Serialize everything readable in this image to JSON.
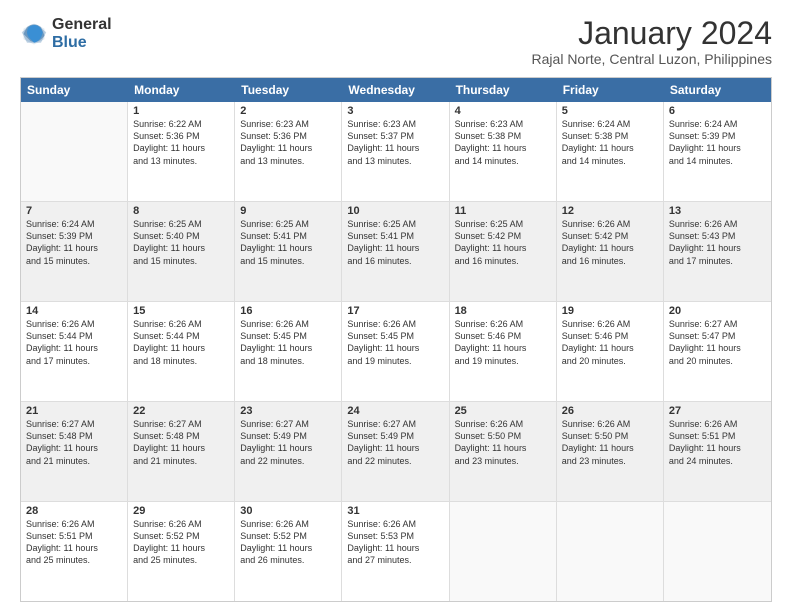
{
  "logo": {
    "line1": "General",
    "line2": "Blue"
  },
  "title": "January 2024",
  "subtitle": "Rajal Norte, Central Luzon, Philippines",
  "header_days": [
    "Sunday",
    "Monday",
    "Tuesday",
    "Wednesday",
    "Thursday",
    "Friday",
    "Saturday"
  ],
  "weeks": [
    [
      {
        "day": "",
        "lines": [],
        "empty": true
      },
      {
        "day": "1",
        "lines": [
          "Sunrise: 6:22 AM",
          "Sunset: 5:36 PM",
          "Daylight: 11 hours",
          "and 13 minutes."
        ]
      },
      {
        "day": "2",
        "lines": [
          "Sunrise: 6:23 AM",
          "Sunset: 5:36 PM",
          "Daylight: 11 hours",
          "and 13 minutes."
        ]
      },
      {
        "day": "3",
        "lines": [
          "Sunrise: 6:23 AM",
          "Sunset: 5:37 PM",
          "Daylight: 11 hours",
          "and 13 minutes."
        ]
      },
      {
        "day": "4",
        "lines": [
          "Sunrise: 6:23 AM",
          "Sunset: 5:38 PM",
          "Daylight: 11 hours",
          "and 14 minutes."
        ]
      },
      {
        "day": "5",
        "lines": [
          "Sunrise: 6:24 AM",
          "Sunset: 5:38 PM",
          "Daylight: 11 hours",
          "and 14 minutes."
        ]
      },
      {
        "day": "6",
        "lines": [
          "Sunrise: 6:24 AM",
          "Sunset: 5:39 PM",
          "Daylight: 11 hours",
          "and 14 minutes."
        ]
      }
    ],
    [
      {
        "day": "7",
        "lines": [
          "Sunrise: 6:24 AM",
          "Sunset: 5:39 PM",
          "Daylight: 11 hours",
          "and 15 minutes."
        ]
      },
      {
        "day": "8",
        "lines": [
          "Sunrise: 6:25 AM",
          "Sunset: 5:40 PM",
          "Daylight: 11 hours",
          "and 15 minutes."
        ]
      },
      {
        "day": "9",
        "lines": [
          "Sunrise: 6:25 AM",
          "Sunset: 5:41 PM",
          "Daylight: 11 hours",
          "and 15 minutes."
        ]
      },
      {
        "day": "10",
        "lines": [
          "Sunrise: 6:25 AM",
          "Sunset: 5:41 PM",
          "Daylight: 11 hours",
          "and 16 minutes."
        ]
      },
      {
        "day": "11",
        "lines": [
          "Sunrise: 6:25 AM",
          "Sunset: 5:42 PM",
          "Daylight: 11 hours",
          "and 16 minutes."
        ]
      },
      {
        "day": "12",
        "lines": [
          "Sunrise: 6:26 AM",
          "Sunset: 5:42 PM",
          "Daylight: 11 hours",
          "and 16 minutes."
        ]
      },
      {
        "day": "13",
        "lines": [
          "Sunrise: 6:26 AM",
          "Sunset: 5:43 PM",
          "Daylight: 11 hours",
          "and 17 minutes."
        ]
      }
    ],
    [
      {
        "day": "14",
        "lines": [
          "Sunrise: 6:26 AM",
          "Sunset: 5:44 PM",
          "Daylight: 11 hours",
          "and 17 minutes."
        ]
      },
      {
        "day": "15",
        "lines": [
          "Sunrise: 6:26 AM",
          "Sunset: 5:44 PM",
          "Daylight: 11 hours",
          "and 18 minutes."
        ]
      },
      {
        "day": "16",
        "lines": [
          "Sunrise: 6:26 AM",
          "Sunset: 5:45 PM",
          "Daylight: 11 hours",
          "and 18 minutes."
        ]
      },
      {
        "day": "17",
        "lines": [
          "Sunrise: 6:26 AM",
          "Sunset: 5:45 PM",
          "Daylight: 11 hours",
          "and 19 minutes."
        ]
      },
      {
        "day": "18",
        "lines": [
          "Sunrise: 6:26 AM",
          "Sunset: 5:46 PM",
          "Daylight: 11 hours",
          "and 19 minutes."
        ]
      },
      {
        "day": "19",
        "lines": [
          "Sunrise: 6:26 AM",
          "Sunset: 5:46 PM",
          "Daylight: 11 hours",
          "and 20 minutes."
        ]
      },
      {
        "day": "20",
        "lines": [
          "Sunrise: 6:27 AM",
          "Sunset: 5:47 PM",
          "Daylight: 11 hours",
          "and 20 minutes."
        ]
      }
    ],
    [
      {
        "day": "21",
        "lines": [
          "Sunrise: 6:27 AM",
          "Sunset: 5:48 PM",
          "Daylight: 11 hours",
          "and 21 minutes."
        ]
      },
      {
        "day": "22",
        "lines": [
          "Sunrise: 6:27 AM",
          "Sunset: 5:48 PM",
          "Daylight: 11 hours",
          "and 21 minutes."
        ]
      },
      {
        "day": "23",
        "lines": [
          "Sunrise: 6:27 AM",
          "Sunset: 5:49 PM",
          "Daylight: 11 hours",
          "and 22 minutes."
        ]
      },
      {
        "day": "24",
        "lines": [
          "Sunrise: 6:27 AM",
          "Sunset: 5:49 PM",
          "Daylight: 11 hours",
          "and 22 minutes."
        ]
      },
      {
        "day": "25",
        "lines": [
          "Sunrise: 6:26 AM",
          "Sunset: 5:50 PM",
          "Daylight: 11 hours",
          "and 23 minutes."
        ]
      },
      {
        "day": "26",
        "lines": [
          "Sunrise: 6:26 AM",
          "Sunset: 5:50 PM",
          "Daylight: 11 hours",
          "and 23 minutes."
        ]
      },
      {
        "day": "27",
        "lines": [
          "Sunrise: 6:26 AM",
          "Sunset: 5:51 PM",
          "Daylight: 11 hours",
          "and 24 minutes."
        ]
      }
    ],
    [
      {
        "day": "28",
        "lines": [
          "Sunrise: 6:26 AM",
          "Sunset: 5:51 PM",
          "Daylight: 11 hours",
          "and 25 minutes."
        ]
      },
      {
        "day": "29",
        "lines": [
          "Sunrise: 6:26 AM",
          "Sunset: 5:52 PM",
          "Daylight: 11 hours",
          "and 25 minutes."
        ]
      },
      {
        "day": "30",
        "lines": [
          "Sunrise: 6:26 AM",
          "Sunset: 5:52 PM",
          "Daylight: 11 hours",
          "and 26 minutes."
        ]
      },
      {
        "day": "31",
        "lines": [
          "Sunrise: 6:26 AM",
          "Sunset: 5:53 PM",
          "Daylight: 11 hours",
          "and 27 minutes."
        ]
      },
      {
        "day": "",
        "lines": [],
        "empty": true
      },
      {
        "day": "",
        "lines": [],
        "empty": true
      },
      {
        "day": "",
        "lines": [],
        "empty": true
      }
    ]
  ]
}
